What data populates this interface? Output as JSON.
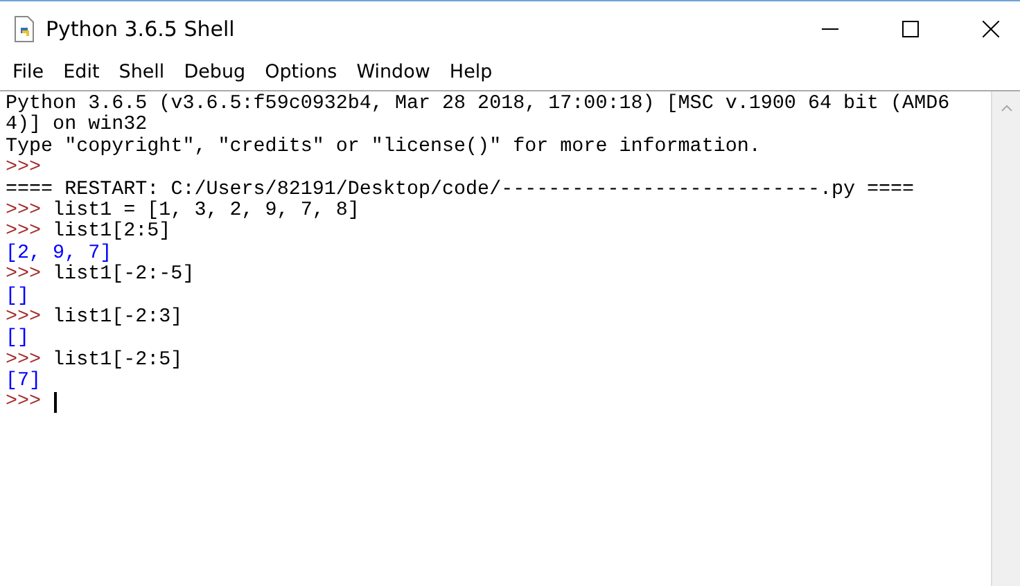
{
  "window": {
    "title": "Python 3.6.5 Shell"
  },
  "menu": [
    "File",
    "Edit",
    "Shell",
    "Debug",
    "Options",
    "Window",
    "Help"
  ],
  "lines": [
    {
      "kind": "output",
      "text": "Python 3.6.5 (v3.6.5:f59c0932b4, Mar 28 2018, 17:00:18) [MSC v.1900 64 bit (AMD6"
    },
    {
      "kind": "output",
      "text": "4)] on win32"
    },
    {
      "kind": "output",
      "text": "Type \"copyright\", \"credits\" or \"license()\" for more information."
    },
    {
      "kind": "prompt",
      "prompt": ">>>"
    },
    {
      "kind": "output",
      "text": "==== RESTART: C:/Users/82191/Desktop/code/---------------------------.py ===="
    },
    {
      "kind": "prompt",
      "prompt": ">>>",
      "text": "list1 = [1, 3, 2, 9, 7, 8]"
    },
    {
      "kind": "prompt",
      "prompt": ">>>",
      "text": "list1[2:5]"
    },
    {
      "kind": "result",
      "text": "[2, 9, 7]"
    },
    {
      "kind": "prompt",
      "prompt": ">>>",
      "text": "list1[-2:-5]"
    },
    {
      "kind": "result",
      "text": "[]"
    },
    {
      "kind": "prompt",
      "prompt": ">>>",
      "text": "list1[-2:3]"
    },
    {
      "kind": "result",
      "text": "[]"
    },
    {
      "kind": "prompt",
      "prompt": ">>>",
      "text": "list1[-2:5]"
    },
    {
      "kind": "result",
      "text": "[7]"
    },
    {
      "kind": "cursor",
      "prompt": ">>>"
    }
  ]
}
